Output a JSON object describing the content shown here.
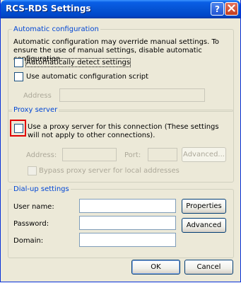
{
  "window": {
    "title": "RCS-RDS Settings",
    "help_glyph": "?",
    "close_glyph": "✕"
  },
  "auto_config": {
    "legend": "Automatic configuration",
    "description": "Automatic configuration may override manual settings.  To ensure the use of manual settings, disable automatic configuration.",
    "detect_label": "Automatically detect settings",
    "detect_checked": false,
    "script_label": "Use automatic configuration script",
    "script_checked": false,
    "address_label": "Address",
    "address_value": ""
  },
  "proxy": {
    "legend": "Proxy server",
    "use_proxy_label": "Use a proxy server for this connection (These settings will not apply to other connections).",
    "use_proxy_checked": false,
    "address_label": "Address:",
    "address_value": "",
    "port_label": "Port:",
    "port_value": "",
    "advanced_label": "Advanced...",
    "bypass_label": "Bypass proxy server for local addresses",
    "bypass_checked": false
  },
  "dialup": {
    "legend": "Dial-up settings",
    "username_label": "User name:",
    "username_value": "",
    "password_label": "Password:",
    "password_value": "",
    "domain_label": "Domain:",
    "domain_value": "",
    "properties_label": "Properties",
    "advanced_label": "Advanced"
  },
  "footer": {
    "ok_label": "OK",
    "cancel_label": "Cancel"
  },
  "colors": {
    "titlebar": "#0553d4",
    "dialog_bg": "#ece9d8",
    "group_legend": "#0046d5",
    "highlight": "#e00000"
  }
}
